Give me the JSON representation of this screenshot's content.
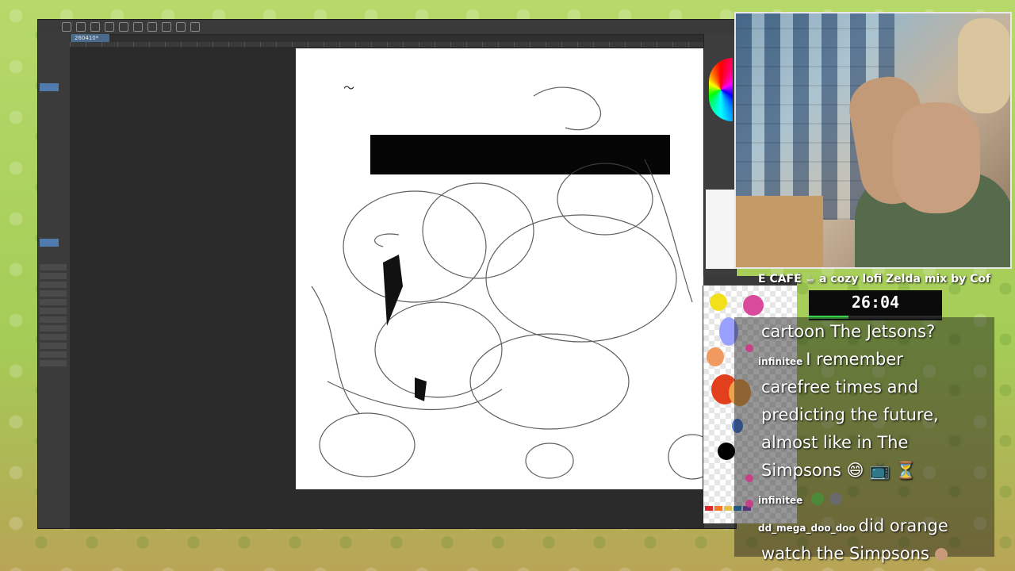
{
  "app": {
    "doc_tab_label": "260410*",
    "toolbar_icons": [
      "new-file-icon",
      "open-icon",
      "save-icon",
      "undo-icon",
      "redo-icon",
      "settings-icon",
      "fill-icon",
      "brush-icon",
      "transform-icon",
      "ruler-icon"
    ]
  },
  "canvas": {
    "sky_panel_color": "#050505"
  },
  "palette": {
    "colors": [
      "#f2e01a",
      "#9aa0ff",
      "#e2401c",
      "#f0a24a",
      "#000000",
      "#4a7bd8",
      "#d94a9b",
      "#f09a60"
    ],
    "chips": [
      "#e02828",
      "#f07a2a",
      "#e4c24a",
      "#2a8ad0",
      "#8a4ad0"
    ]
  },
  "stream": {
    "now_playing": "E CAFÉ ☕ a cozy lofi Zelda mix by Cof",
    "timer": "26:04",
    "timer_progress": 0.3
  },
  "chat": {
    "lines": [
      {
        "user": "",
        "text": "cartoon The Jetsons?"
      },
      {
        "user": "infinitee",
        "text": "I remember"
      },
      {
        "user": "",
        "text": "carefree times and"
      },
      {
        "user": "",
        "text": "predicting the future,"
      },
      {
        "user": "",
        "text": "almost like in The"
      },
      {
        "user": "",
        "text": "Simpsons 😄 📺 ⏳"
      },
      {
        "user": "infinitee",
        "text": ""
      },
      {
        "user": "dd_mega_doo_doo",
        "text": "did orange"
      },
      {
        "user": "",
        "text": "watch the Simpsons"
      }
    ]
  }
}
